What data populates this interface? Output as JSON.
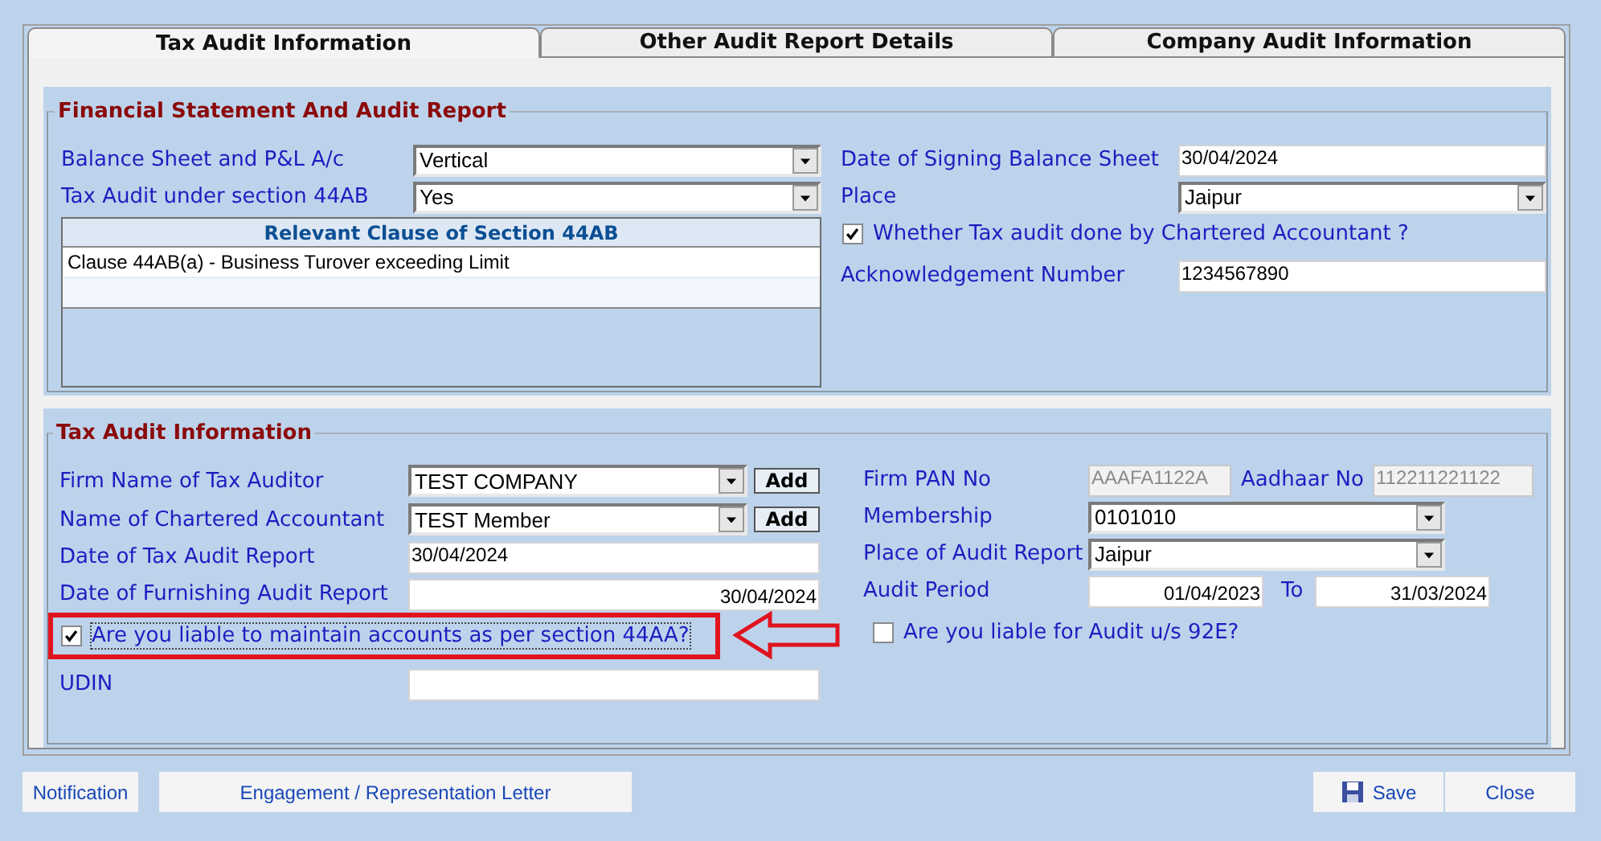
{
  "tabs": [
    {
      "label": "Tax Audit Information",
      "selected": true
    },
    {
      "label": "Other Audit Report Details",
      "selected": false
    },
    {
      "label": "Company Audit Information",
      "selected": false
    }
  ],
  "financial_statement": {
    "title": "Financial Statement And Audit Report",
    "left": [
      {
        "kind": "select",
        "label": "Balance Sheet and P&L A/c",
        "value": "Vertical"
      },
      {
        "kind": "select",
        "label": "Tax Audit  under section 44AB",
        "value": "Yes"
      }
    ],
    "clause_table": {
      "header": "Relevant Clause of Section 44AB",
      "rows": [
        "Clause 44AB(a) - Business Turover exceeding Limit"
      ]
    },
    "right": [
      {
        "kind": "text",
        "label": "Date of Signing Balance Sheet",
        "value": "30/04/2024"
      },
      {
        "kind": "select",
        "label": "Place",
        "value": "Jaipur"
      },
      {
        "kind": "checkbox",
        "label": "Whether Tax audit done by Chartered Accountant ?",
        "checked": true,
        "highlighted": false
      },
      {
        "kind": "text",
        "label": "Acknowledgement Number",
        "value": "1234567890"
      }
    ]
  },
  "tax_audit": {
    "title": "Tax Audit Information",
    "left": [
      {
        "kind": "select_add",
        "label": "Firm Name of Tax Auditor",
        "value": "TEST COMPANY",
        "button": "Add"
      },
      {
        "kind": "select_add",
        "label": "Name of Chartered Accountant",
        "value": "TEST Member",
        "button": "Add"
      },
      {
        "kind": "text",
        "label": "Date of Tax Audit Report",
        "value": "30/04/2024"
      },
      {
        "kind": "text_right",
        "label": "Date of Furnishing Audit Report",
        "value": "30/04/2024"
      },
      {
        "kind": "checkbox",
        "label": "Are you liable to maintain accounts as per section 44AA?",
        "checked": true,
        "highlighted": true
      },
      {
        "kind": "text",
        "label": "UDIN"
      }
    ],
    "right": [
      {
        "kind": "pair",
        "label": "Firm PAN No",
        "value": "AAAFA1122A",
        "label2": "Aadhaar No",
        "value2": "112211221122",
        "disabled": true
      },
      {
        "kind": "select",
        "label": "Membership",
        "value": "0101010"
      },
      {
        "kind": "select",
        "label": "Place of Audit Report",
        "value": "Jaipur"
      },
      {
        "kind": "range",
        "label": "Audit Period",
        "value": "01/04/2023",
        "label2": "To",
        "value2": "31/03/2024"
      },
      {
        "kind": "checkbox",
        "label": "Are you liable for Audit  u/s 92E?",
        "checked": false,
        "highlighted": false
      }
    ]
  },
  "footer": {
    "left": [
      {
        "label": "Notification"
      },
      {
        "label": "Engagement / Representation Letter"
      }
    ],
    "right": [
      {
        "label": "Save",
        "kind": "save"
      },
      {
        "label": "Close",
        "kind": "plain"
      }
    ]
  }
}
